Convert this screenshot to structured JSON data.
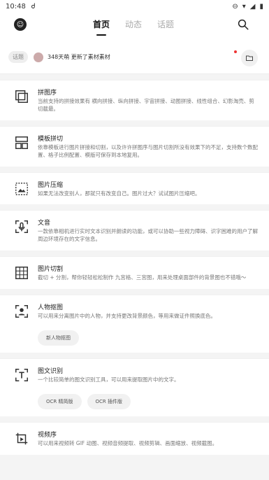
{
  "status": {
    "time": "10:48",
    "extra": "Ꮷ"
  },
  "tabs": [
    {
      "label": "首页"
    },
    {
      "label": "动态"
    },
    {
      "label": "话题"
    }
  ],
  "notice": {
    "tag": "话题",
    "text": "348天萌 更新了素材素材"
  },
  "cards": [
    {
      "title": "拼图序",
      "desc": "当前支持的拼接效果有 横向拼接、纵向拼接、宇宙拼接、动图拼接、线性组合、幻影淘壳、剪切截最。",
      "icon": "collage-icon"
    },
    {
      "title": "模板拼切",
      "desc": "依靠模板进行图片拼接和切割，以及许许拼图序与图片切割所没有效果下的不足，支持数个数配置、格子比例配置、模版可保存到本地复用。",
      "icon": "template-icon"
    },
    {
      "title": "图片压缩",
      "desc": "如果无法改变别人，那就只有改变自己。图片过大？试试图片压缩吧。",
      "icon": "compress-icon"
    },
    {
      "title": "文音",
      "desc": "一款依靠相机进行实时文本识别并朗读的功能，或可以协助一些视力障碍、识字困难的用户了解周边环境存在的文字信息。",
      "icon": "voice-icon"
    },
    {
      "title": "图片切割",
      "desc": "截切 + 分割，帮你轻轻松松制作 九宫格、三宫图，用来处理桌面部件的背景图也不错哦～",
      "icon": "grid-icon"
    },
    {
      "title": "人物抠图",
      "desc": "可以用来分离图片中的人物，并支持更改背景颜色，等用来做证件照换底色。",
      "icon": "portrait-icon",
      "chips": [
        "新人物抠图"
      ]
    },
    {
      "title": "图文识别",
      "desc": "一个比较简单的图文识别工具，可以用来提取图片中的文字。",
      "icon": "text-recognize-icon",
      "chips": [
        "OCR 精简版",
        "OCR 插件版"
      ]
    },
    {
      "title": "视频序",
      "desc": "可以用来视频转 GIF 动图、视频音频提取、视频剪辑、画面缩放、视频截图。",
      "icon": "video-icon"
    }
  ]
}
